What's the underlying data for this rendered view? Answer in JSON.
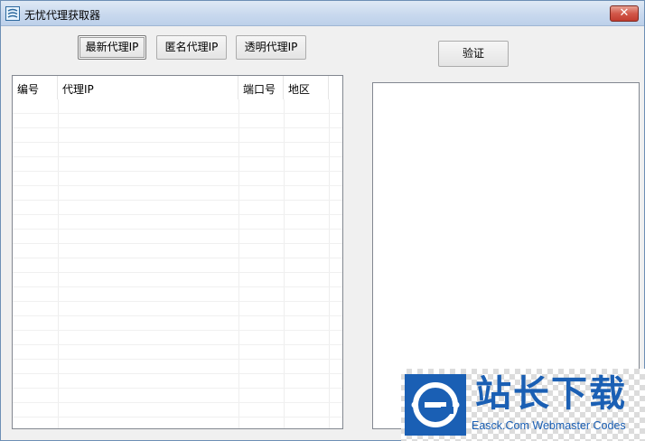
{
  "window": {
    "title": "无忧代理获取器",
    "close_symbol": "✕"
  },
  "toolbar": {
    "latest_label": "最新代理IP",
    "anonymous_label": "匿名代理IP",
    "transparent_label": "透明代理IP",
    "verify_label": "验证"
  },
  "table": {
    "columns": [
      "编号",
      "代理IP",
      "端口号",
      "地区"
    ],
    "rows": []
  },
  "watermark": {
    "title": "站长下载",
    "subtitle": "Easck.Com Webmaster Codes",
    "color": "#1a5fb4"
  }
}
